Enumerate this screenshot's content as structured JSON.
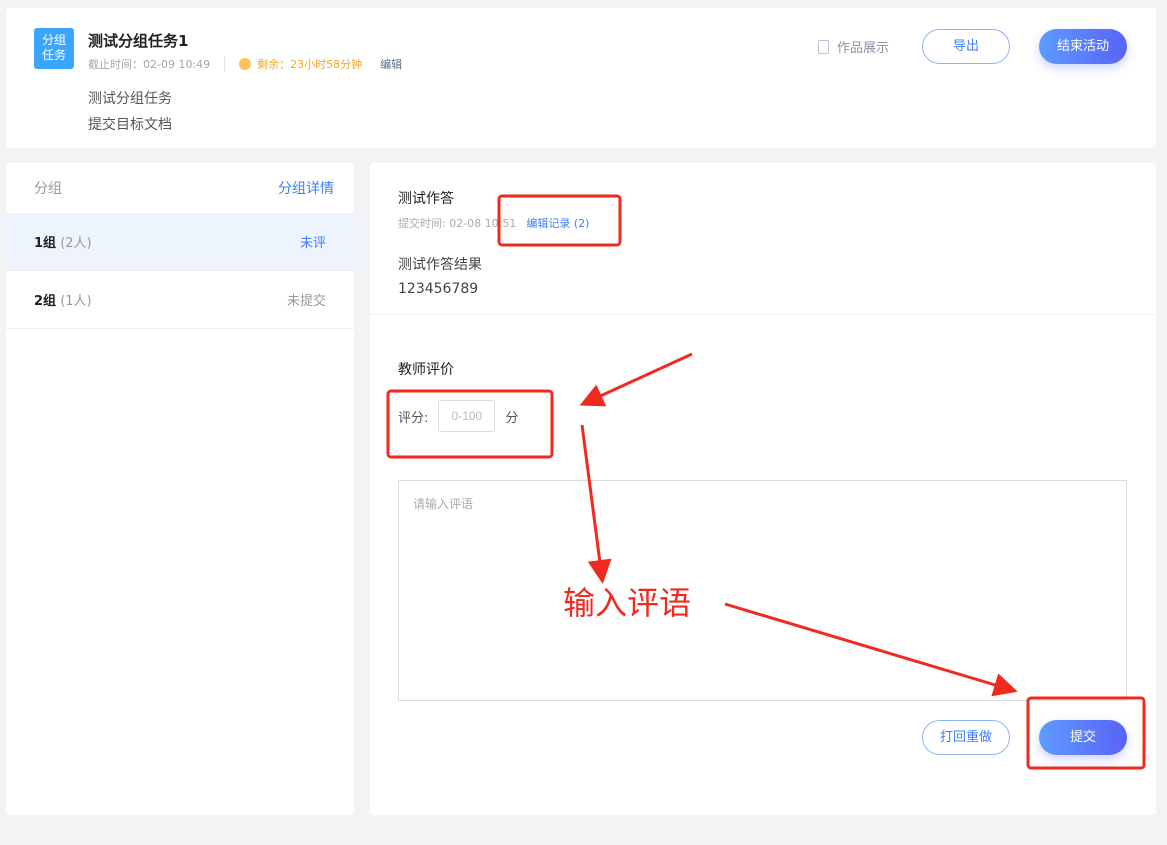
{
  "header": {
    "badge": "分组 任务",
    "badge_l1": "分组",
    "badge_l2": "任务",
    "title": "测试分组任务1",
    "deadline": "截止时间：02-09 10:49",
    "remaining": "剩余：23小时58分钟",
    "edit": "编辑",
    "desc1": "测试分组任务",
    "desc2": "提交目标文档",
    "showcase": "作品展示",
    "export": "导出",
    "end": "结束活动"
  },
  "sidebar": {
    "title": "分组",
    "detail": "分组详情",
    "groups": [
      {
        "name": "1组",
        "count": "(2人)",
        "status": "未评"
      },
      {
        "name": "2组",
        "count": "(1人)",
        "status": "未提交"
      }
    ]
  },
  "main": {
    "answer_title": "测试作答",
    "submit_time": "提交时间: 02-08 10:51",
    "edit_history": "编辑记录 (2)",
    "result_title": "测试作答结果",
    "result_value": "123456789",
    "eval_title": "教师评价",
    "score_label": "评分:",
    "score_placeholder": "0-100",
    "score_unit": "分",
    "comment_placeholder": "请输入评语",
    "return_btn": "打回重做",
    "submit_btn": "提交"
  },
  "annotation": {
    "text": "输入评语",
    "color": "#f02a1f"
  }
}
